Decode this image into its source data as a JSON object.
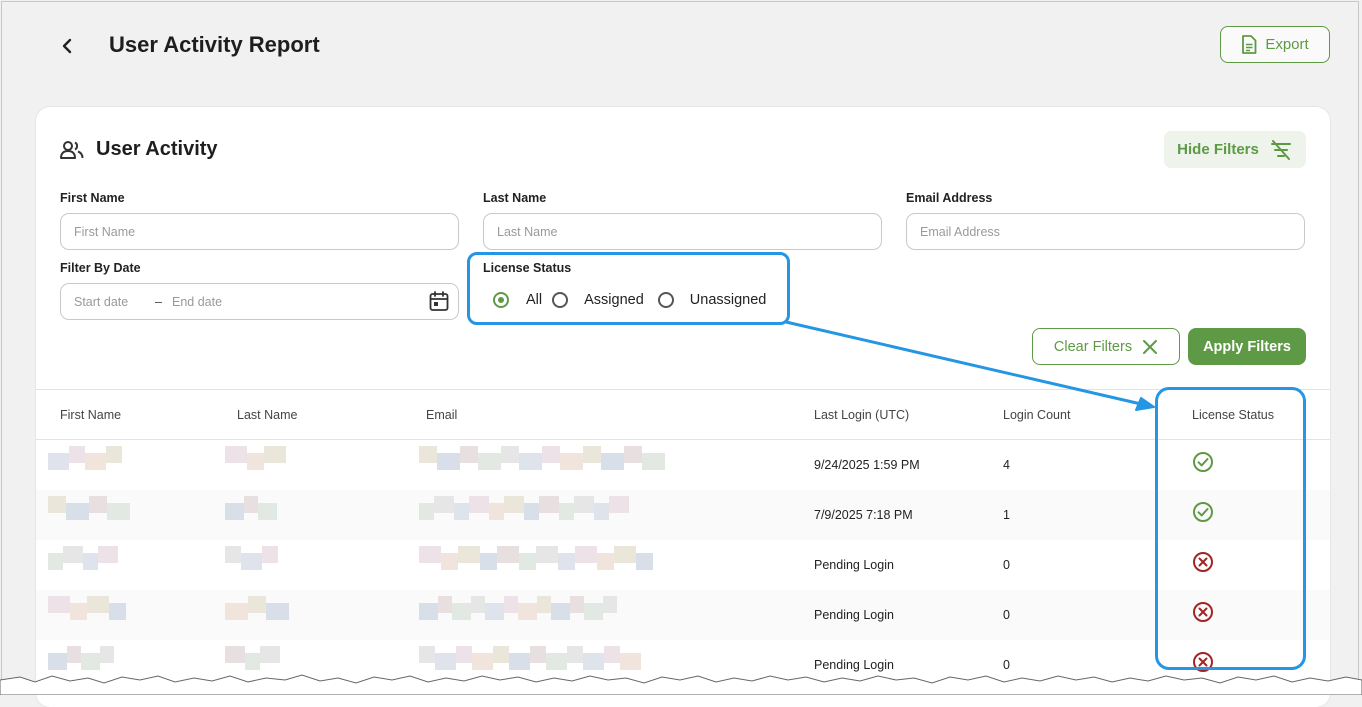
{
  "header": {
    "title": "User Activity Report",
    "export_label": "Export"
  },
  "card": {
    "title": "User Activity",
    "hide_filters_label": "Hide Filters"
  },
  "filters": {
    "first_name": {
      "label": "First Name",
      "placeholder": "First Name",
      "value": ""
    },
    "last_name": {
      "label": "Last Name",
      "placeholder": "Last Name",
      "value": ""
    },
    "email": {
      "label": "Email Address",
      "placeholder": "Email Address",
      "value": ""
    },
    "date": {
      "label": "Filter By Date",
      "start_placeholder": "Start date",
      "separator": "–",
      "end_placeholder": "End date"
    },
    "license": {
      "label": "License Status",
      "options": [
        "All",
        "Assigned",
        "Unassigned"
      ],
      "selected": "All"
    },
    "clear_label": "Clear Filters",
    "apply_label": "Apply Filters"
  },
  "table": {
    "columns": [
      "First Name",
      "Last Name",
      "Email",
      "Last Login (UTC)",
      "Login Count",
      "License Status"
    ],
    "rows": [
      {
        "last_login": "9/24/2025 1:59 PM",
        "login_count": "4",
        "license": "assigned"
      },
      {
        "last_login": "7/9/2025 7:18 PM",
        "login_count": "1",
        "license": "assigned"
      },
      {
        "last_login": "Pending Login",
        "login_count": "0",
        "license": "unassigned"
      },
      {
        "last_login": "Pending Login",
        "login_count": "0",
        "license": "unassigned"
      },
      {
        "last_login": "Pending Login",
        "login_count": "0",
        "license": "unassigned"
      }
    ]
  },
  "colors": {
    "accent": "#5e9a45",
    "assigned": "#5e9a45",
    "unassigned": "#a32424",
    "callout": "#2496e3"
  },
  "icons": {
    "back": "chevron-left-icon",
    "export": "document-icon",
    "card": "users-icon",
    "hide_filters": "filter-off-icon",
    "date": "calendar-icon",
    "clear": "close-icon",
    "assigned": "check-circle-icon",
    "unassigned": "x-circle-icon"
  }
}
